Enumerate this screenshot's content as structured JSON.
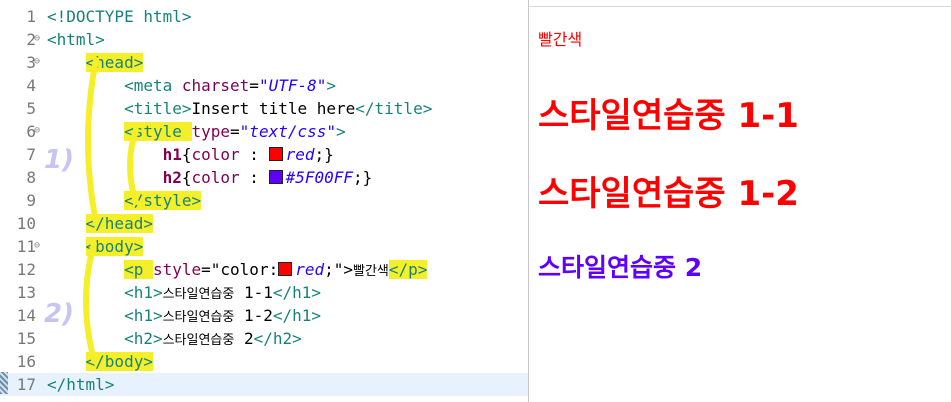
{
  "editor": {
    "lines": [
      {
        "n": "1",
        "parts": [
          {
            "t": "<!DOCTYPE html>",
            "c": "tag"
          }
        ]
      },
      {
        "n": "2",
        "fold": "⊖",
        "parts": [
          {
            "t": "<html>",
            "c": "tag"
          }
        ]
      },
      {
        "n": "3",
        "fold": "⊖",
        "parts": [
          {
            "t": "    "
          },
          {
            "t": "<head>",
            "c": "tag hl"
          }
        ]
      },
      {
        "n": "4",
        "parts": [
          {
            "t": "        "
          },
          {
            "t": "<meta ",
            "c": "tag"
          },
          {
            "t": "charset",
            "c": "attr"
          },
          {
            "t": "=",
            "c": ""
          },
          {
            "t": "\"UTF-8\"",
            "c": "str"
          },
          {
            "t": ">",
            "c": "tag"
          }
        ]
      },
      {
        "n": "5",
        "parts": [
          {
            "t": "        "
          },
          {
            "t": "<title>",
            "c": "tag"
          },
          {
            "t": "Insert title here",
            "c": ""
          },
          {
            "t": "</title>",
            "c": "tag"
          }
        ]
      },
      {
        "n": "6",
        "fold": "⊖",
        "parts": [
          {
            "t": "        "
          },
          {
            "t": "<style ",
            "c": "tag hl"
          },
          {
            "t": "type",
            "c": "attr"
          },
          {
            "t": "=",
            "c": ""
          },
          {
            "t": "\"text/css\"",
            "c": "str"
          },
          {
            "t": ">",
            "c": "tag"
          }
        ]
      },
      {
        "n": "7",
        "parts": [
          {
            "t": "            "
          },
          {
            "t": "h1",
            "c": "kw"
          },
          {
            "t": "{",
            "c": ""
          },
          {
            "t": "color",
            "c": "attr"
          },
          {
            "t": " : ",
            "c": ""
          },
          {
            "t": "",
            "swatch": "#ff0000"
          },
          {
            "t": "red",
            "c": "val"
          },
          {
            "t": ";}",
            "c": ""
          }
        ]
      },
      {
        "n": "8",
        "parts": [
          {
            "t": "            "
          },
          {
            "t": "h2",
            "c": "kw"
          },
          {
            "t": "{",
            "c": ""
          },
          {
            "t": "color",
            "c": "attr"
          },
          {
            "t": " : ",
            "c": ""
          },
          {
            "t": "",
            "swatch": "#5f00ff"
          },
          {
            "t": "#5F00FF",
            "c": "val"
          },
          {
            "t": ";}",
            "c": ""
          }
        ]
      },
      {
        "n": "9",
        "parts": [
          {
            "t": "        "
          },
          {
            "t": "</style>",
            "c": "tag hl"
          }
        ]
      },
      {
        "n": "10",
        "parts": [
          {
            "t": "    "
          },
          {
            "t": "</head>",
            "c": "tag hl"
          }
        ]
      },
      {
        "n": "11",
        "fold": "⊖",
        "parts": [
          {
            "t": "    "
          },
          {
            "t": "<body>",
            "c": "tag hl"
          }
        ]
      },
      {
        "n": "12",
        "parts": [
          {
            "t": "        "
          },
          {
            "t": "<p ",
            "c": "tag hl"
          },
          {
            "t": "style",
            "c": "attr"
          },
          {
            "t": "=\"color:",
            "c": ""
          },
          {
            "t": "",
            "swatch": "#ff0000"
          },
          {
            "t": "red",
            "c": "val"
          },
          {
            "t": ";\">",
            "c": ""
          },
          {
            "t": "빨간색",
            "c": "kr"
          },
          {
            "t": "</p>",
            "c": "tag hl"
          }
        ]
      },
      {
        "n": "13",
        "parts": [
          {
            "t": "        "
          },
          {
            "t": "<h1>",
            "c": "tag"
          },
          {
            "t": "스타일연습중",
            "c": "kr"
          },
          {
            "t": " 1-1",
            "c": ""
          },
          {
            "t": "</h1>",
            "c": "tag"
          }
        ]
      },
      {
        "n": "14",
        "parts": [
          {
            "t": "        "
          },
          {
            "t": "<h1>",
            "c": "tag"
          },
          {
            "t": "스타일연습중",
            "c": "kr"
          },
          {
            "t": " 1-2",
            "c": ""
          },
          {
            "t": "</h1>",
            "c": "tag"
          }
        ]
      },
      {
        "n": "15",
        "parts": [
          {
            "t": "        "
          },
          {
            "t": "<h2>",
            "c": "tag"
          },
          {
            "t": "스타일연습중",
            "c": "kr"
          },
          {
            "t": " 2",
            "c": ""
          },
          {
            "t": "</h2>",
            "c": "tag"
          }
        ]
      },
      {
        "n": "16",
        "parts": [
          {
            "t": "    "
          },
          {
            "t": "</body>",
            "c": "tag hl"
          }
        ]
      },
      {
        "n": "17",
        "current": true,
        "parts": [
          {
            "t": "</html>",
            "c": "tag"
          }
        ]
      }
    ],
    "annotations": [
      "1)",
      "2)"
    ]
  },
  "preview": {
    "p_text": "빨간색",
    "h1_first": "스타일연습중 1-1",
    "h1_second": "스타일연습중 1-2",
    "h2_text": "스타일연습중 2"
  },
  "colors": {
    "red": "#ff0000",
    "purple": "#5f00ff",
    "highlighter": "#f5ef2a",
    "marker": "#c7c4f2"
  }
}
